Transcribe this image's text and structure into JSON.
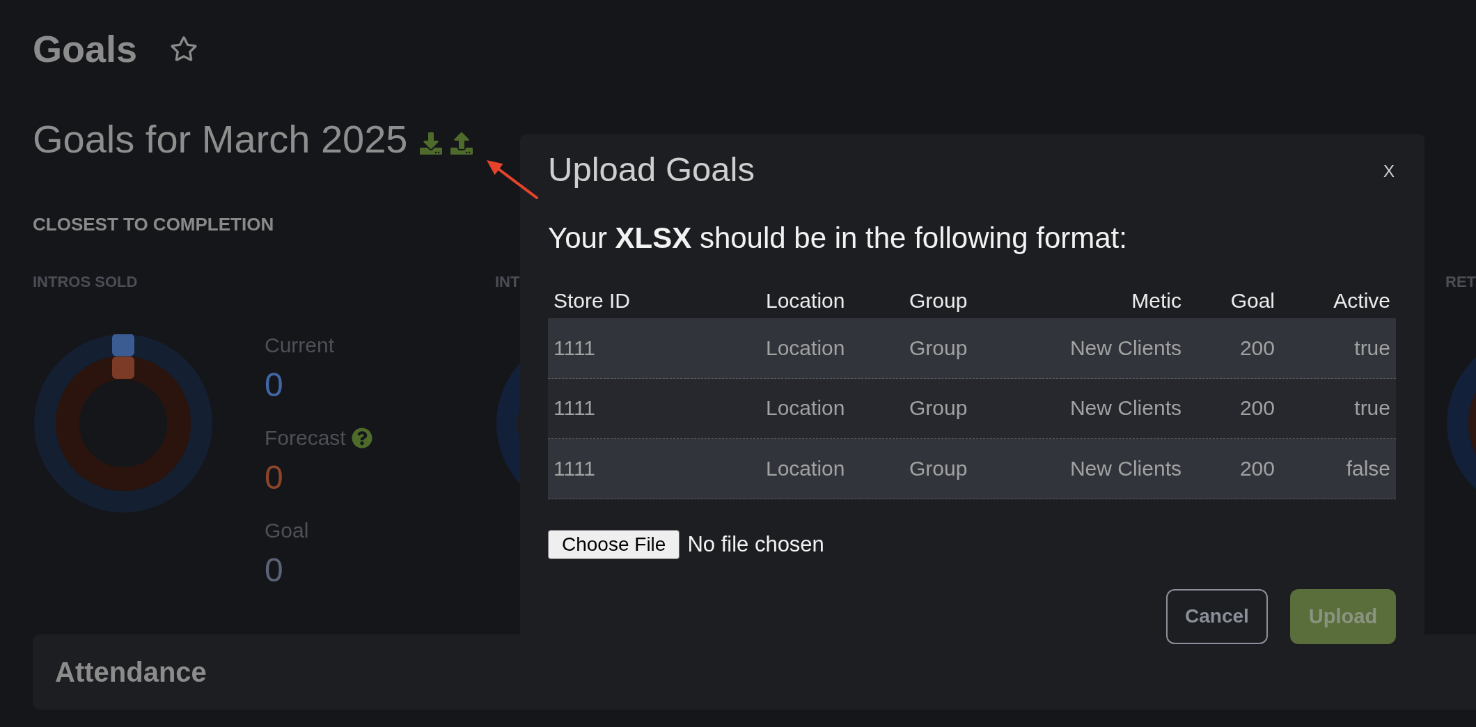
{
  "page": {
    "title": "Goals",
    "starred": false
  },
  "period": {
    "title": "Goals for March 2025"
  },
  "section": {
    "heading": "CLOSEST TO COMPLETION"
  },
  "cards": [
    {
      "title": "INTROS SOLD",
      "rings": [
        {
          "color": "#3b5b93"
        },
        {
          "color": "#7b3b26"
        }
      ],
      "stats": [
        {
          "label": "Current",
          "value": "0",
          "color": "#4266a6",
          "help": false
        },
        {
          "label": "Forecast",
          "value": "0",
          "color": "#8c4529",
          "help": true
        },
        {
          "label": "Goal",
          "value": "0",
          "color": "#5b6476",
          "help": false
        }
      ]
    },
    {
      "title": "INT"
    },
    {
      "title": "RET"
    }
  ],
  "modal": {
    "title": "Upload Goals",
    "close": "X",
    "instruction": "Your **XLSX** should be in the following format:",
    "table": {
      "columns": [
        "Store ID",
        "Location",
        "Group",
        "Metic",
        "Goal",
        "Active"
      ],
      "rows": [
        [
          "1111",
          "Location",
          "Group",
          "New Clients",
          "200",
          "true"
        ],
        [
          "1111",
          "Location",
          "Group",
          "New Clients",
          "200",
          "true"
        ],
        [
          "1111",
          "Location",
          "Group",
          "New Clients",
          "200",
          "false"
        ]
      ]
    },
    "file_button": "Choose File",
    "file_status": "No file chosen",
    "cancel_button": {
      "label": "Cancel"
    },
    "upload_button": {
      "label": "Upload",
      "disabled": true
    }
  },
  "panel": {
    "title": "Attendance"
  }
}
